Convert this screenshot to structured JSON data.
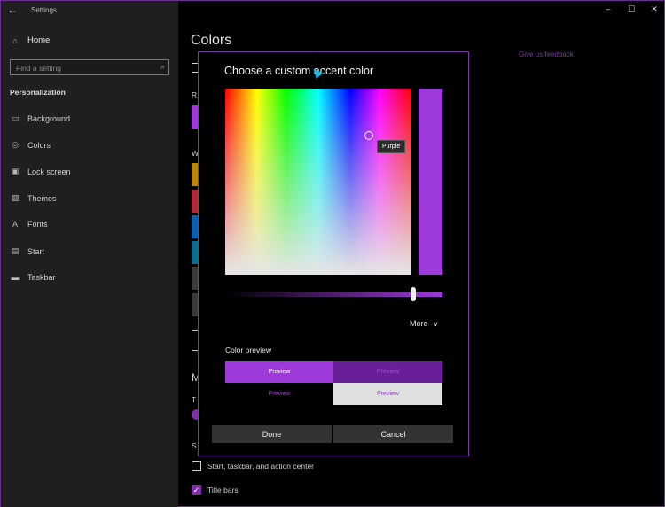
{
  "window": {
    "app_title": "Settings",
    "back_icon": "back-arrow-icon",
    "controls": {
      "minimize": "–",
      "maximize": "☐",
      "close": "✕"
    }
  },
  "sidebar": {
    "home": {
      "label": "Home",
      "icon": "home-icon"
    },
    "search": {
      "placeholder": "Find a setting",
      "icon": "search-icon"
    },
    "section": "Personalization",
    "items": [
      {
        "label": "Background",
        "icon": "image-icon",
        "glyph": "▭"
      },
      {
        "label": "Colors",
        "icon": "palette-icon",
        "glyph": "◎"
      },
      {
        "label": "Lock screen",
        "icon": "lock-screen-icon",
        "glyph": "▣"
      },
      {
        "label": "Themes",
        "icon": "themes-icon",
        "glyph": "▨"
      },
      {
        "label": "Fonts",
        "icon": "fonts-icon",
        "glyph": "A"
      },
      {
        "label": "Start",
        "icon": "start-icon",
        "glyph": "▤"
      },
      {
        "label": "Taskbar",
        "icon": "taskbar-icon",
        "glyph": "▬"
      }
    ]
  },
  "content": {
    "title": "Colors",
    "feedback_link": "Give us feedback",
    "partial_labels": {
      "r": "R",
      "w": "W",
      "m": "M",
      "t": "T",
      "s": "S"
    },
    "swatch_colors": [
      "#b8860b",
      "#b0283c",
      "#0b5fb0",
      "#0a6e8c",
      "#3a3a3a",
      "#3a3a3a"
    ],
    "accent_surfaces": [
      {
        "label": "Start, taskbar, and action center",
        "checked": false
      },
      {
        "label": "Title bars",
        "checked": true
      }
    ]
  },
  "dialog": {
    "title": "Choose a custom accent color",
    "tooltip": "Purple",
    "selected_color": "#9d3ad9",
    "brightness_value": 0.95,
    "more_label": "More",
    "preview_label": "Color preview",
    "previews": [
      "Preview",
      "Preview",
      "Preview",
      "Preview"
    ],
    "done_label": "Done",
    "cancel_label": "Cancel"
  }
}
